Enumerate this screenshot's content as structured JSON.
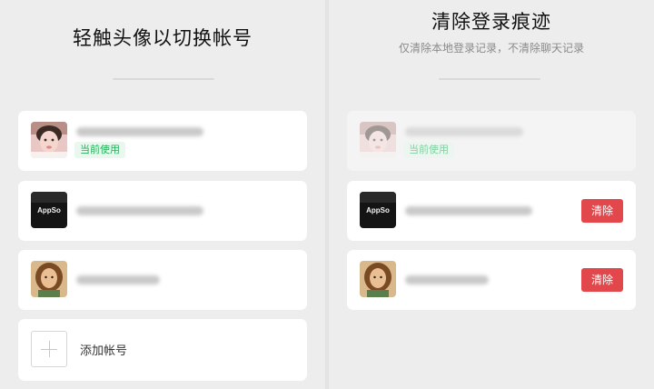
{
  "left_panel": {
    "title": "轻触头像以切换帐号",
    "accounts": [
      {
        "avatar": "girl-photo-avatar",
        "status_badge": "当前使用"
      },
      {
        "avatar": "appso-logo-avatar"
      },
      {
        "avatar": "illustrated-woman-avatar"
      }
    ],
    "add_account_label": "添加帐号"
  },
  "right_panel": {
    "title": "清除登录痕迹",
    "subtitle": "仅清除本地登录记录，不清除聊天记录",
    "accounts": [
      {
        "avatar": "girl-photo-avatar",
        "status_badge": "当前使用"
      },
      {
        "avatar": "appso-logo-avatar",
        "clear_label": "清除"
      },
      {
        "avatar": "illustrated-woman-avatar",
        "clear_label": "清除"
      }
    ]
  },
  "appso_logo_text": "AppSo",
  "colors": {
    "clear_button": "#e2474b",
    "badge_text": "#23b15a",
    "badge_bg": "#e9f7ee"
  }
}
